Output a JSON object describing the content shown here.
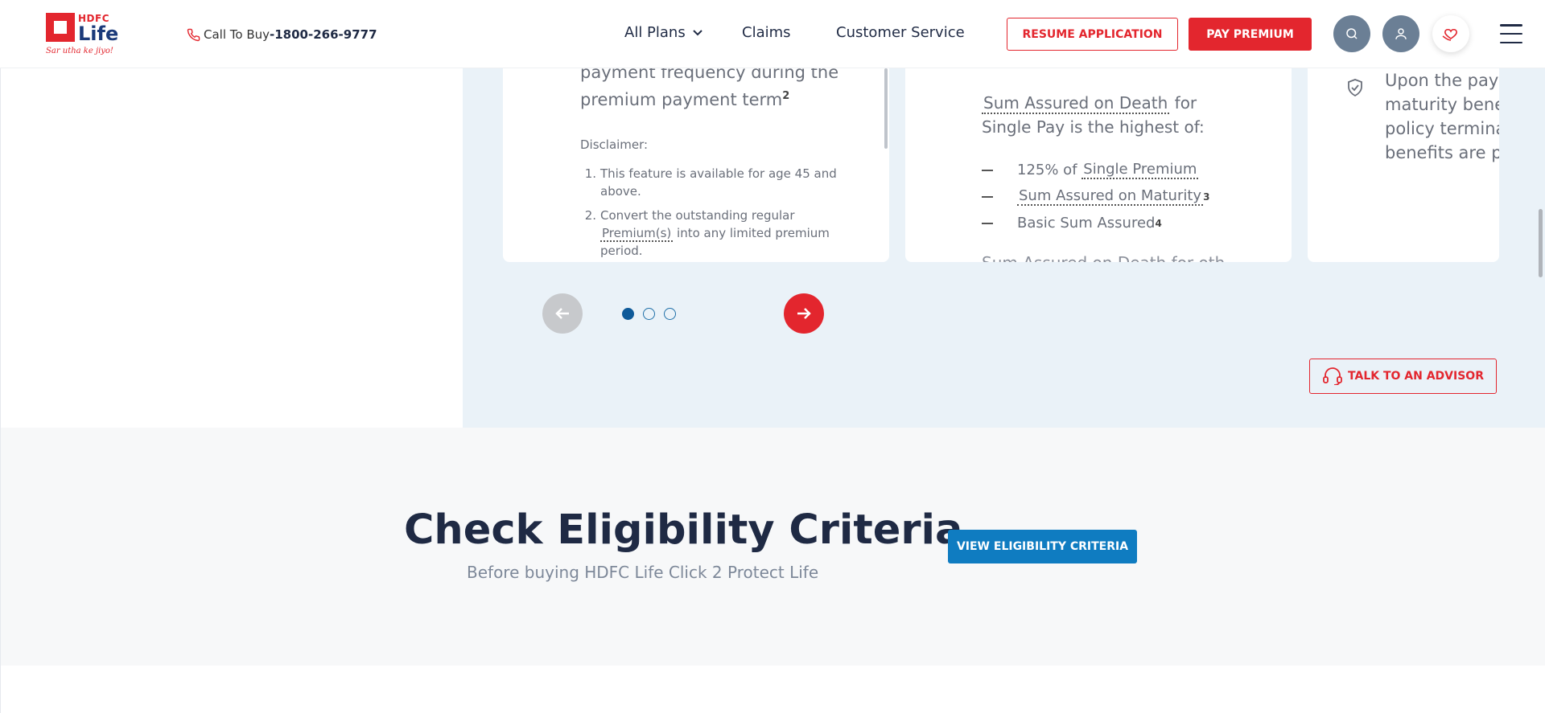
{
  "header": {
    "logo_brand": "HDFC",
    "logo_name": "Life",
    "logo_tagline": "Sar utha ke jiyo!",
    "call_label": "Call To Buy",
    "call_number": "-1800-266-9777",
    "nav": {
      "all_plans": "All Plans",
      "claims": "Claims",
      "customer_service": "Customer Service"
    },
    "resume_label": "RESUME APPLICATION",
    "pay_label": "PAY PREMIUM",
    "icons": [
      "phone-icon",
      "chevron-down-icon",
      "search-icon",
      "user-icon",
      "heart-hand-icon",
      "hamburger-menu-icon"
    ]
  },
  "carousel": {
    "card1": {
      "text_line1": "payment frequency during the",
      "text_line2": "premium payment term",
      "text_sup": "2",
      "disclaimer_label": "Disclaimer:",
      "item1_num": "1.",
      "item1_text": "This feature is available for age 45 and above.",
      "item2_num": "2.",
      "item2_pre": "Convert the outstanding regular",
      "item2_link": "Premium(s)",
      "item2_post": "into any limited premium period."
    },
    "card2": {
      "intro_link": "Sum Assured on Death",
      "intro_mid": "for",
      "intro_line2": "Single Pay is the highest of:",
      "item1_pre": "125% of",
      "item1_link": "Single Premium",
      "item2_link": "Sum Assured on Maturity",
      "item2_sup": "3",
      "item3_text": "Basic Sum Assured",
      "item3_sup": "4",
      "cut_text": "Sum Assured on Death for oth"
    },
    "card3": {
      "line1": "Upon the paym",
      "line2": "maturity bene",
      "line3": "policy termina",
      "line4": "benefits are pa"
    },
    "active_dot": 0,
    "dot_count": 3,
    "advisor_label": "TALK TO AN ADVISOR"
  },
  "eligibility": {
    "title": "Check Eligibility Criteria",
    "subtitle": "Before buying HDFC Life Click 2 Protect Life",
    "button_label": "VIEW ELIGIBILITY CRITERIA"
  },
  "colors": {
    "brand_red": "#e3262e",
    "brand_navy": "#1f2a44",
    "accent_blue": "#0f7cc1",
    "section_blue_bg": "#eaf2f8"
  }
}
